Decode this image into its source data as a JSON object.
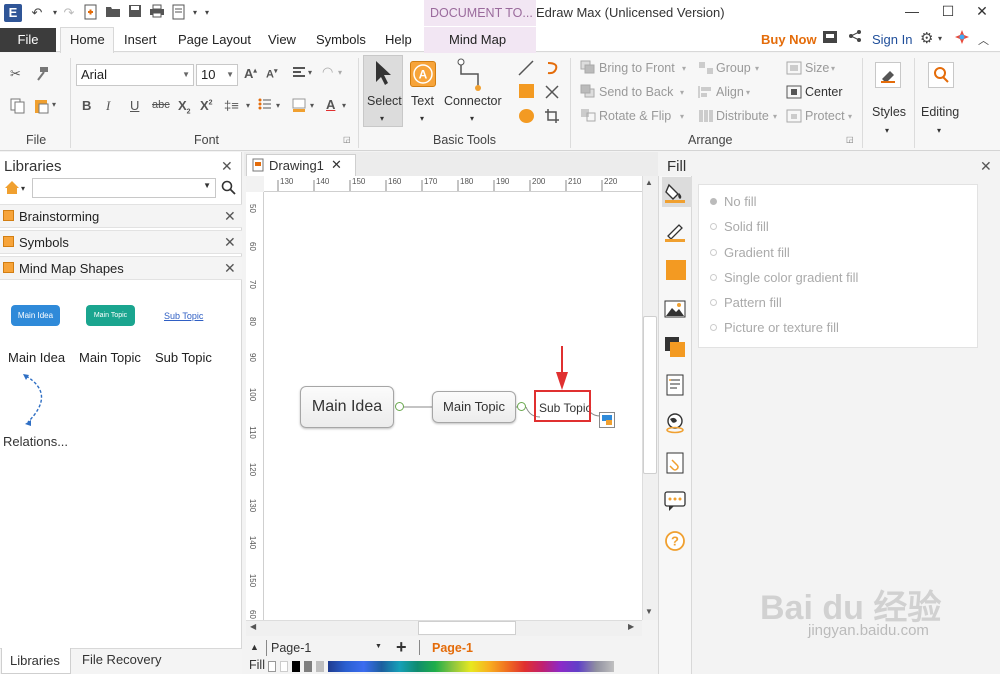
{
  "titlebar": {
    "doc_tools_label": "DOCUMENT TO...",
    "window_title": "Edraw Max (Unlicensed Version)",
    "app_logo": "E"
  },
  "menu": {
    "file": "File",
    "home": "Home",
    "insert": "Insert",
    "page_layout": "Page Layout",
    "view": "View",
    "symbols": "Symbols",
    "help": "Help",
    "mind_map": "Mind Map",
    "buy_now": "Buy Now",
    "sign_in": "Sign In"
  },
  "ribbon": {
    "groups": {
      "file": "File",
      "font": "Font",
      "basic_tools": "Basic Tools",
      "arrange": "Arrange"
    },
    "font_name": "Arial",
    "font_size": "10",
    "select": "Select",
    "text": "Text",
    "connector": "Connector",
    "bring_to_front": "Bring to Front",
    "send_to_back": "Send to Back",
    "rotate_flip": "Rotate & Flip",
    "group": "Group",
    "align": "Align",
    "distribute": "Distribute",
    "size": "Size",
    "center": "Center",
    "protect": "Protect",
    "styles": "Styles",
    "editing": "Editing"
  },
  "libraries": {
    "title": "Libraries",
    "items": [
      {
        "label": "Brainstorming"
      },
      {
        "label": "Symbols"
      },
      {
        "label": "Mind Map Shapes"
      }
    ],
    "shapes": [
      {
        "thumb": "Main Idea",
        "label": "Main Idea"
      },
      {
        "thumb": "Main Topic",
        "label": "Main Topic"
      },
      {
        "thumb": "Sub Topic",
        "label": "Sub Topic"
      },
      {
        "label": "Relations..."
      }
    ],
    "tab_libraries": "Libraries",
    "tab_file_recovery": "File Recovery"
  },
  "document": {
    "tab_label": "Drawing1",
    "hruler": [
      "130",
      "140",
      "150",
      "160",
      "170",
      "180",
      "190",
      "200",
      "210",
      "220"
    ],
    "vruler": [
      "50",
      "60",
      "70",
      "80",
      "90",
      "100",
      "110",
      "120",
      "130",
      "140",
      "150",
      "60"
    ],
    "nodes": {
      "main_idea": "Main Idea",
      "main_topic": "Main Topic",
      "sub_topic": "Sub Topic"
    }
  },
  "pagebar": {
    "page_select": "Page-1",
    "page_tab": "Page-1",
    "fill_label": "Fill"
  },
  "fill_panel": {
    "title": "Fill",
    "options": [
      "No fill",
      "Solid fill",
      "Gradient fill",
      "Single color gradient fill",
      "Pattern fill",
      "Picture or texture fill"
    ]
  },
  "watermark": {
    "main": "Bai du 经验",
    "sub": "jingyan.baidu.com"
  },
  "colors": {
    "accent_orange": "#e46c0a",
    "highlight_red": "#e03030",
    "main_idea_blue": "#2f8ad9",
    "main_topic_teal": "#1aa58f"
  }
}
